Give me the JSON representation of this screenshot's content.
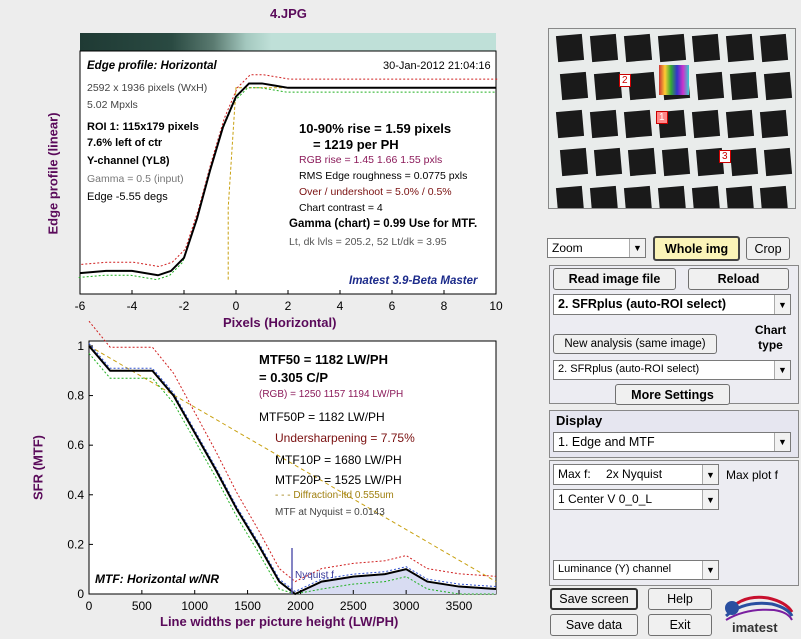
{
  "title": "4.JPG",
  "top_plot": {
    "header_title": "Edge profile: Horizontal",
    "timestamp": "30-Jan-2012 21:04:16",
    "info": [
      "2592 x 1936 pixels (WxH)",
      "5.02 Mpxls"
    ],
    "roi": [
      "ROI 1:  115x179 pixels",
      "7.6% left of ctr"
    ],
    "channel": "Y-channel  (YL8)",
    "gamma_input": "Gamma = 0.5 (input)",
    "edge_angle": "Edge -5.55 degs",
    "rise_line1": "10-90% rise = 1.59 pixels",
    "rise_line2": "= 1219 per PH",
    "rgb_rise": "RGB rise = 1.45  1.66  1.55 pxls",
    "rms": "RMS Edge roughness = 0.0775 pxls",
    "overshoot": "Over / undershoot = 5.0% / 0.5%",
    "chart_contrast": "Chart contrast = 4",
    "gamma_chart": "Gamma (chart) = 0.99  Use for MTF.",
    "levels": "Lt, dk lvls = 205.2, 52   Lt/dk = 3.95",
    "watermark": "Imatest 3.9-Beta Master",
    "ylabel": "Edge profile (linear)",
    "xlabel": "Pixels (Horizontal)",
    "xticks": [
      "-6",
      "-4",
      "-2",
      "0",
      "2",
      "4",
      "6",
      "8",
      "10"
    ]
  },
  "bottom_plot": {
    "mtf50": "MTF50 = 1182 LW/PH",
    "cp": "= 0.305 C/P",
    "rgb": "(RGB) = 1250  1157  1194 LW/PH",
    "mtf50p": "MTF50P = 1182 LW/PH",
    "undersharp": "Undersharpening = 7.75%",
    "mtf10p": "MTF10P = 1680 LW/PH",
    "mtf20p": "MTF20P = 1525 LW/PH",
    "diffraction": "- - - Diffraction-ltd  0.555um",
    "nyq": "MTF at Nyquist = 0.0143",
    "nyquist_label": "Nyquist f",
    "watermark": "MTF: Horizontal w/NR",
    "ylabel": "SFR (MTF)",
    "xlabel": "Line widths per picture height (LW/PH)",
    "xticks": [
      "0",
      "500",
      "1000",
      "1500",
      "2000",
      "2500",
      "3000",
      "3500"
    ],
    "yticks": [
      "0",
      "0.2",
      "0.4",
      "0.6",
      "0.8",
      "1"
    ]
  },
  "chart_data": [
    {
      "type": "line",
      "title": "Edge profile: Horizontal",
      "xlabel": "Pixels (Horizontal)",
      "ylabel": "Edge profile (linear)",
      "xlim": [
        -6,
        10
      ],
      "ylim": [
        0,
        1
      ],
      "series": [
        {
          "name": "Y",
          "x": [
            -6,
            -5,
            -4,
            -3,
            -2.5,
            -2,
            -1.5,
            -1,
            -0.5,
            0,
            0.5,
            1,
            1.5,
            2,
            3,
            4,
            6,
            8,
            10
          ],
          "y": [
            0.05,
            0.06,
            0.06,
            0.04,
            0.06,
            0.12,
            0.3,
            0.52,
            0.72,
            0.86,
            0.92,
            0.92,
            0.91,
            0.9,
            0.9,
            0.9,
            0.9,
            0.9,
            0.9
          ]
        }
      ]
    },
    {
      "type": "line",
      "title": "",
      "xlabel": "Line widths per picture height (LW/PH)",
      "ylabel": "SFR (MTF)",
      "xlim": [
        0,
        3850
      ],
      "ylim": [
        0,
        1.02
      ],
      "series": [
        {
          "name": "Y",
          "x": [
            0,
            200,
            400,
            600,
            800,
            1000,
            1200,
            1400,
            1600,
            1800,
            1950,
            2200,
            2500,
            2800,
            3000,
            3200,
            3500,
            3850
          ],
          "y": [
            1,
            0.9,
            0.9,
            0.9,
            0.8,
            0.65,
            0.5,
            0.34,
            0.2,
            0.05,
            0.0,
            0.05,
            0.07,
            0.08,
            0.1,
            0.05,
            0.03,
            0.02
          ]
        }
      ]
    }
  ],
  "right_panel": {
    "zoom": "Zoom",
    "whole_img": "Whole img",
    "crop": "Crop",
    "read_image": "Read image file",
    "reload": "Reload",
    "analysis_select": "2. SFRplus (auto-ROI select)",
    "chart_type_label": "Chart type",
    "new_analysis": "New analysis (same image)",
    "chart_type_select": "2. SFRplus (auto-ROI select)",
    "more_settings": "More Settings",
    "display_label": "Display",
    "display_select": "1.  Edge and MTF",
    "maxf_label": "Max f:",
    "maxf_select": "2x Nyquist",
    "max_plot_label": "Max plot f",
    "roi_select": "1  Center   V      0_0_L",
    "channel_select": "Luminance (Y) channel",
    "save_screen": "Save screen",
    "help": "Help",
    "save_data": "Save data",
    "exit": "Exit",
    "logo_text": "imatest",
    "thumb_labels": [
      "2",
      "1",
      "3"
    ]
  }
}
